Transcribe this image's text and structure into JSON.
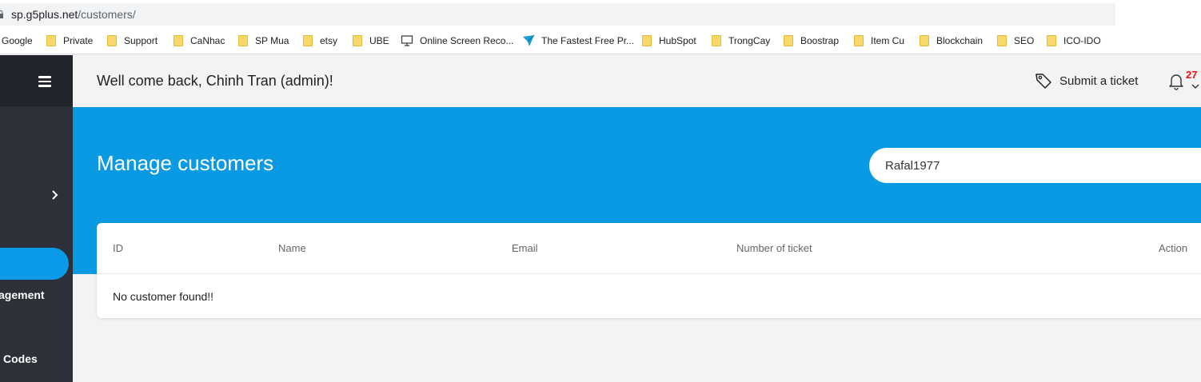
{
  "browser": {
    "url_host": "sp.g5plus.net",
    "url_path": "/customers/",
    "bookmarks": [
      {
        "label": "Google",
        "icon": "none"
      },
      {
        "label": "Private",
        "icon": "folder-icon"
      },
      {
        "label": "Support",
        "icon": "folder-icon"
      },
      {
        "label": "CaNhac",
        "icon": "folder-icon"
      },
      {
        "label": "SP Mua",
        "icon": "folder-icon"
      },
      {
        "label": "etsy",
        "icon": "folder-icon"
      },
      {
        "label": "UBE",
        "icon": "folder-icon"
      },
      {
        "label": "Online Screen Reco...",
        "icon": "monitor-icon"
      },
      {
        "label": "The Fastest Free Pr...",
        "icon": "bolt-icon"
      },
      {
        "label": "HubSpot",
        "icon": "folder-icon"
      },
      {
        "label": "TrongCay",
        "icon": "folder-icon"
      },
      {
        "label": "Boostrap",
        "icon": "folder-icon"
      },
      {
        "label": "Item Cu",
        "icon": "folder-icon"
      },
      {
        "label": "Blockchain",
        "icon": "folder-icon"
      },
      {
        "label": "SEO",
        "icon": "folder-icon"
      },
      {
        "label": "ICO-IDO",
        "icon": "folder-icon"
      }
    ]
  },
  "sidebar": {
    "items": [
      {
        "label": "agement"
      },
      {
        "label": "Codes"
      }
    ]
  },
  "header": {
    "welcome": "Well come back, Chinh Tran (admin)!",
    "submit_ticket": "Submit a ticket",
    "notification_count": "27"
  },
  "hero": {
    "title": "Manage customers",
    "search_value": "Rafal1977"
  },
  "table": {
    "columns": [
      "ID",
      "Name",
      "Email",
      "Number of ticket",
      "Action"
    ],
    "empty_message": "No customer found!!"
  },
  "colors": {
    "accent": "#0a9ae3",
    "sidebar": "#2e3039",
    "badge": "#e11111"
  }
}
